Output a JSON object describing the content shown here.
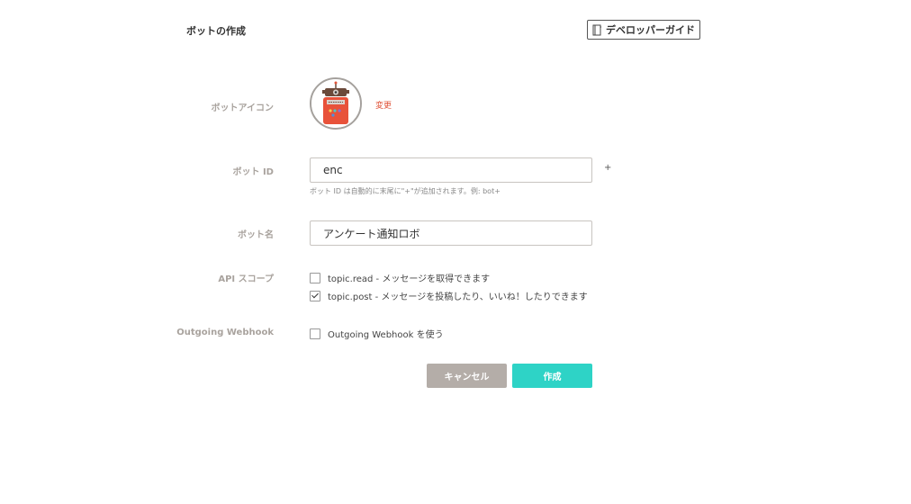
{
  "header": {
    "title": "ボットの作成",
    "developer_guide_label": "デベロッパーガイド"
  },
  "form": {
    "icon": {
      "label": "ボットアイコン",
      "change_link": "変更"
    },
    "bot_id": {
      "label": "ボット ID",
      "value": "enc",
      "suffix": "+",
      "hint": "ボット ID は自動的に末尾に\"+\"が追加されます。例: bot+"
    },
    "bot_name": {
      "label": "ボット名",
      "value": "アンケート通知ロボ"
    },
    "api_scope": {
      "label": "API スコープ",
      "options": [
        {
          "label": "topic.read - メッセージを取得できます",
          "checked": false
        },
        {
          "label": "topic.post - メッセージを投稿したり、いいね！したりできます",
          "checked": true
        }
      ]
    },
    "outgoing_webhook": {
      "label": "Outgoing Webhook",
      "option_label": "Outgoing Webhook を使う",
      "checked": false
    }
  },
  "actions": {
    "cancel_label": "キャンセル",
    "create_label": "作成"
  },
  "colors": {
    "accent_create": "#2ed3c6",
    "cancel": "#b4ada8",
    "link": "#e0543a",
    "label": "#a9a39e"
  },
  "icons": {
    "guide": "book-icon",
    "avatar": "robot-avatar"
  }
}
